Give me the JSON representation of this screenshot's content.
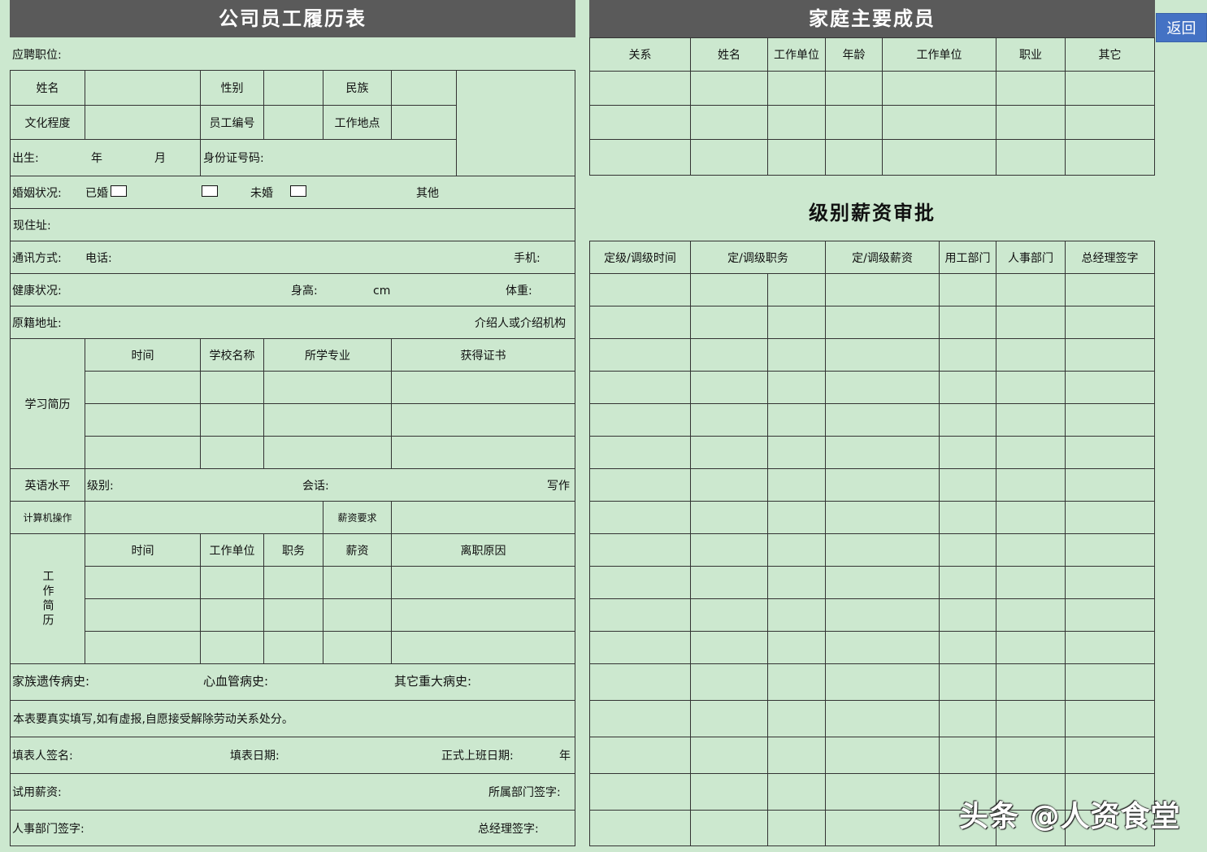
{
  "left_form": {
    "title": "公司员工履历表",
    "position_applied_label": "应聘职位:",
    "name_label": "姓名",
    "gender_label": "性别",
    "ethnicity_label": "民族",
    "education_label": "文化程度",
    "employee_id_label": "员工编号",
    "work_location_label": "工作地点",
    "birth_label": "出生:",
    "birth_year_label": "年",
    "birth_month_label": "月",
    "id_number_label": "身份证号码:",
    "marital_label": "婚姻状况:",
    "married_label": "已婚",
    "unmarried_label": "未婚",
    "other_label": "其他",
    "address_label": "现住址:",
    "contact_label": "通讯方式:",
    "phone_label": "电话:",
    "mobile_label": "手机:",
    "health_label": "健康状况:",
    "height_label": "身高:",
    "height_unit": "cm",
    "weight_label": "体重:",
    "hometown_label": "原籍地址:",
    "referrer_label": "介绍人或介绍机构",
    "study_history_label": "学习简历",
    "study_headers": [
      "时间",
      "学校名称",
      "所学专业",
      "获得证书"
    ],
    "english_label": "英语水平",
    "english_level_label": "级别:",
    "english_speaking_label": "会话:",
    "english_writing_label": "写作",
    "computer_label": "计算机操作",
    "salary_req_label": "薪资要求",
    "work_history_label": "工作简历",
    "work_headers": [
      "时间",
      "工作单位",
      "职务",
      "薪资",
      "离职原因"
    ],
    "family_disease_label": "家族遗传病史:",
    "cardio_label": "心血管病史:",
    "other_disease_label": "其它重大病史:",
    "declaration": "本表要真实填写,如有虚报,自愿接受解除劳动关系处分。",
    "signer_label": "填表人签名:",
    "fill_date_label": "填表日期:",
    "start_date_label": "正式上班日期:",
    "start_year_label": "年",
    "probation_salary_label": "试用薪资:",
    "dept_sign_label": "所属部门签字:",
    "hr_sign_label": "人事部门签字:",
    "gm_sign_label": "总经理签字:"
  },
  "right_form": {
    "family_title": "家庭主要成员",
    "family_headers": [
      "关系",
      "姓名",
      "工作单位",
      "年龄",
      "工作单位",
      "职业",
      "其它"
    ],
    "salary_title": "级别薪资审批",
    "salary_headers": [
      "定级/调级时间",
      "定/调级职务",
      "定/调级薪资",
      "用工部门",
      "人事部门",
      "总经理签字"
    ]
  },
  "back_button": "返回",
  "watermark": "头条 @人资食堂"
}
